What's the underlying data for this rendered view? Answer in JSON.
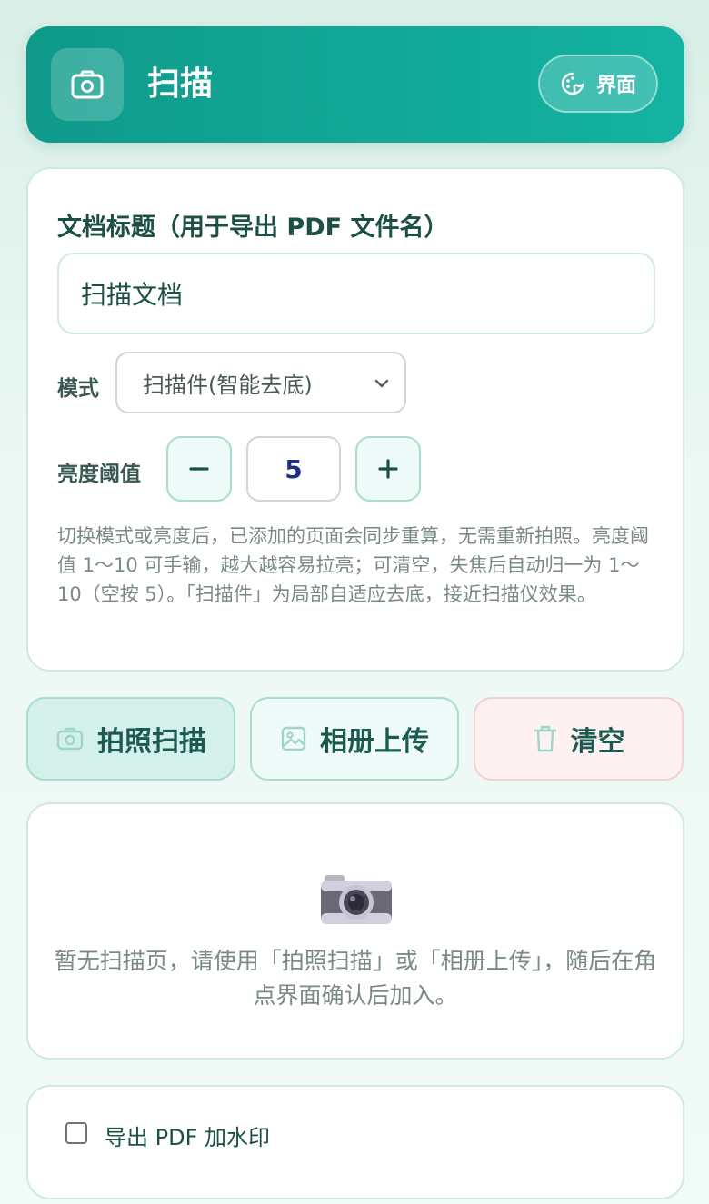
{
  "header": {
    "title": "扫描",
    "title_icon": "camera-icon",
    "theme_button_label": "界面",
    "theme_icon": "palette-icon"
  },
  "settings": {
    "doc_title_label": "文档标题（用于导出 PDF 文件名）",
    "doc_title_value": "扫描文档",
    "mode_label": "模式",
    "mode_selected": "扫描件(智能去底)",
    "brightness_label": "亮度阈值",
    "brightness_value": "5",
    "decrement_symbol": "−",
    "increment_symbol": "+",
    "hint_text": "切换模式或亮度后，已添加的页面会同步重算，无需重新拍照。亮度阈值 1～10 可手输，越大越容易拉亮；可清空，失焦后自动归一为 1～10（空按 5）。「扫描件」为局部自适应去底，接近扫描仪效果。"
  },
  "actions": {
    "camera_label": "拍照扫描",
    "album_label": "相册上传",
    "clear_label": "清空"
  },
  "empty_state": {
    "icon": "camera-icon",
    "message": "暂无扫描页，请使用「拍照扫描」或「相册上传」，随后在角点界面确认后加入。"
  },
  "export": {
    "watermark_label": "导出 PDF 加水印",
    "watermark_checked": false
  },
  "colors": {
    "accent": "#14a897",
    "accent_dark": "#0f9a8a",
    "danger_bg": "#fdf1f1"
  }
}
